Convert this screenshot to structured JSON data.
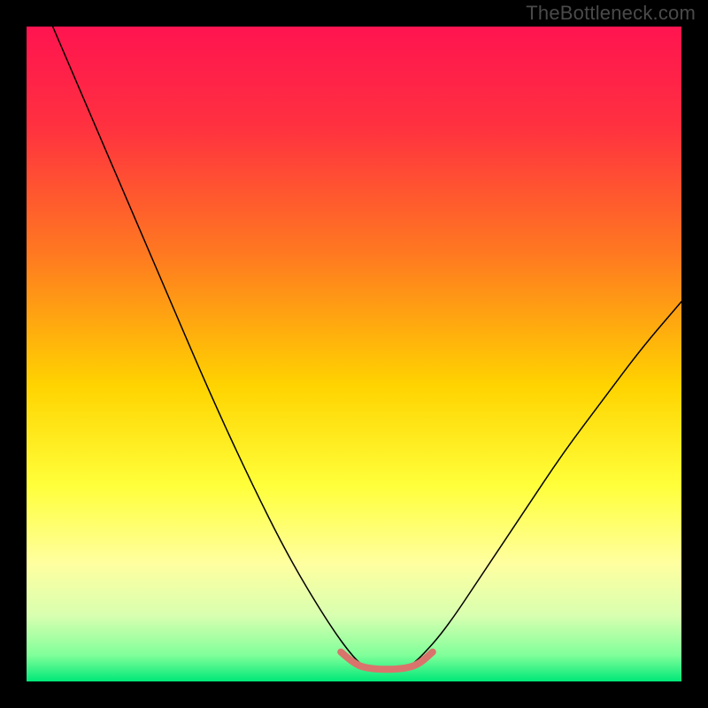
{
  "watermark": "TheBottleneck.com",
  "chart_data": {
    "type": "line",
    "title": "",
    "subtitle": "",
    "xlabel": "",
    "ylabel": "",
    "xlim": [
      0,
      100
    ],
    "ylim": [
      0,
      100
    ],
    "grid": false,
    "legend": "none",
    "description": "Bottleneck curve over a red-to-green vertical heat gradient. A single black V-shaped curve descends steeply from the top-left, bottoms out near x≈55, and rises again toward the right. A short thick salmon segment highlights the flat minimum region.",
    "gradient_stops": [
      {
        "offset": 0.0,
        "color": "#ff1450"
      },
      {
        "offset": 0.15,
        "color": "#ff3040"
      },
      {
        "offset": 0.35,
        "color": "#ff7a20"
      },
      {
        "offset": 0.55,
        "color": "#ffd400"
      },
      {
        "offset": 0.7,
        "color": "#ffff3a"
      },
      {
        "offset": 0.82,
        "color": "#ffffa0"
      },
      {
        "offset": 0.9,
        "color": "#d8ffb0"
      },
      {
        "offset": 0.96,
        "color": "#80ff9a"
      },
      {
        "offset": 1.0,
        "color": "#00e878"
      }
    ],
    "series": [
      {
        "name": "bottleneck-curve",
        "color": "#000000",
        "width": 1.5,
        "points": [
          {
            "x": 4,
            "y": 100
          },
          {
            "x": 10,
            "y": 86
          },
          {
            "x": 16,
            "y": 72
          },
          {
            "x": 22,
            "y": 58
          },
          {
            "x": 28,
            "y": 44
          },
          {
            "x": 34,
            "y": 31
          },
          {
            "x": 40,
            "y": 19
          },
          {
            "x": 46,
            "y": 9
          },
          {
            "x": 50,
            "y": 3.5
          },
          {
            "x": 52,
            "y": 2
          },
          {
            "x": 55,
            "y": 1.5
          },
          {
            "x": 58,
            "y": 2
          },
          {
            "x": 60,
            "y": 3.5
          },
          {
            "x": 64,
            "y": 8
          },
          {
            "x": 70,
            "y": 17
          },
          {
            "x": 76,
            "y": 26
          },
          {
            "x": 82,
            "y": 35
          },
          {
            "x": 88,
            "y": 43
          },
          {
            "x": 94,
            "y": 51
          },
          {
            "x": 100,
            "y": 58
          }
        ]
      },
      {
        "name": "optimal-range-highlight",
        "color": "#d9746c",
        "width": 8,
        "points": [
          {
            "x": 48,
            "y": 4.5
          },
          {
            "x": 50,
            "y": 2.7
          },
          {
            "x": 52,
            "y": 2.0
          },
          {
            "x": 55,
            "y": 1.8
          },
          {
            "x": 58,
            "y": 2.0
          },
          {
            "x": 60,
            "y": 2.7
          },
          {
            "x": 62,
            "y": 4.5
          }
        ]
      }
    ]
  }
}
